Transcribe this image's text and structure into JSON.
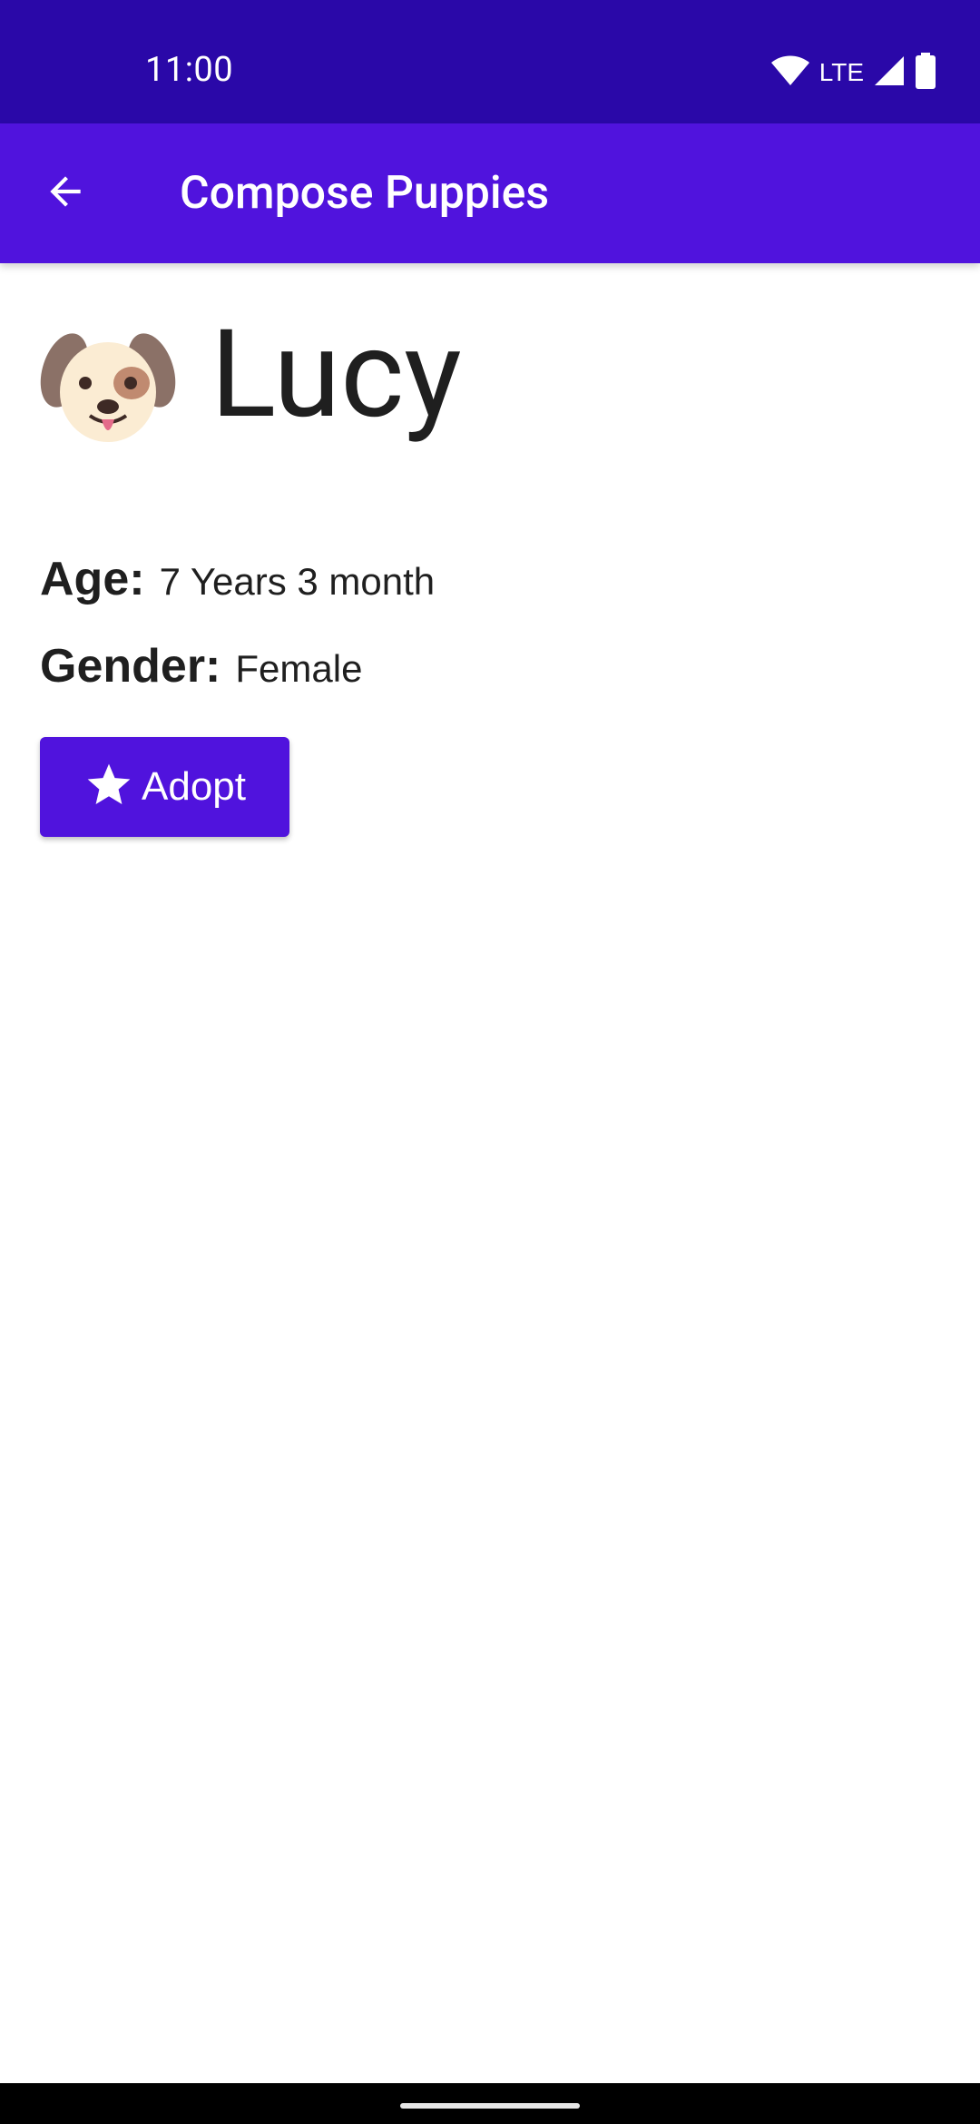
{
  "status_bar": {
    "time": "11:00",
    "network": "LTE",
    "icons": [
      "wifi-icon",
      "cellular-signal-icon",
      "battery-icon"
    ],
    "background": "#2a08a8"
  },
  "app_bar": {
    "title": "Compose Puppies",
    "back_icon": "arrow-back-icon",
    "background": "#5013dd"
  },
  "puppy": {
    "emoji": "🐶",
    "name": "Lucy",
    "age_label": "Age:",
    "age_value": "7 Years 3 month",
    "gender_label": "Gender:",
    "gender_value": "Female"
  },
  "adopt_button": {
    "label": "Adopt",
    "icon": "star-icon",
    "color": "#5013dd"
  }
}
